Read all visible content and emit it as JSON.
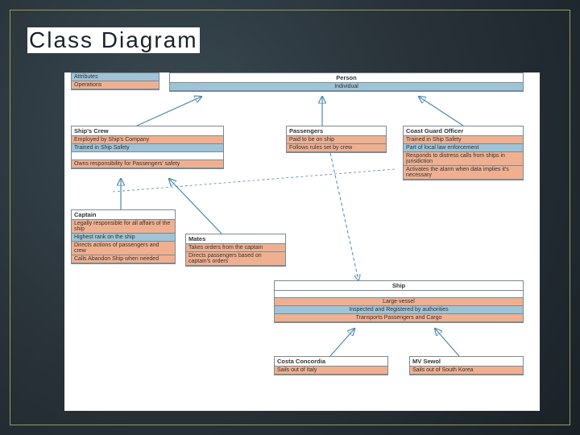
{
  "title": "Class Diagram",
  "person": {
    "name": "Person",
    "attr": "Individual"
  },
  "key": {
    "attributes": "Attributes",
    "operations": "Operations"
  },
  "crew": {
    "name": "Ship's Crew",
    "employed": "Employed by Ship's Company",
    "trained": "Trained in Ship Safety",
    "owns": "Owns responsibility for Passengers' safety"
  },
  "passengers": {
    "name": "Passengers",
    "paid": "Paid to be on ship",
    "follows": "Follows rules set by crew"
  },
  "cgo": {
    "name": "Coast Guard Officer",
    "trained": "Trained in Ship Safety",
    "part": "Part of local law enforcement",
    "responds": "Responds to distress calls from ships in jurisdiction",
    "activates": "Activates the alarm when data implies it's necessary"
  },
  "captain": {
    "name": "Captain",
    "legal": "Legally responsible for all affairs of the ship",
    "rank": "Highest rank on the ship",
    "directs": "Directs actions of passengers and crew",
    "calls": "Calls Abandon Ship when needed"
  },
  "mates": {
    "name": "Mates",
    "takes": "Takes orders from the captain",
    "directs": "Directs passengers based on captain's orders"
  },
  "ship": {
    "name": "Ship",
    "large": "Large vessel",
    "inspected": "Inspected and Registered by authorities",
    "transports": "Transports Passengers and Cargo"
  },
  "costa": {
    "name": "Costa Concordia",
    "sails": "Sails out of Italy"
  },
  "sewol": {
    "name": "MV Sewol",
    "sails": "Sails out of South Korea"
  }
}
